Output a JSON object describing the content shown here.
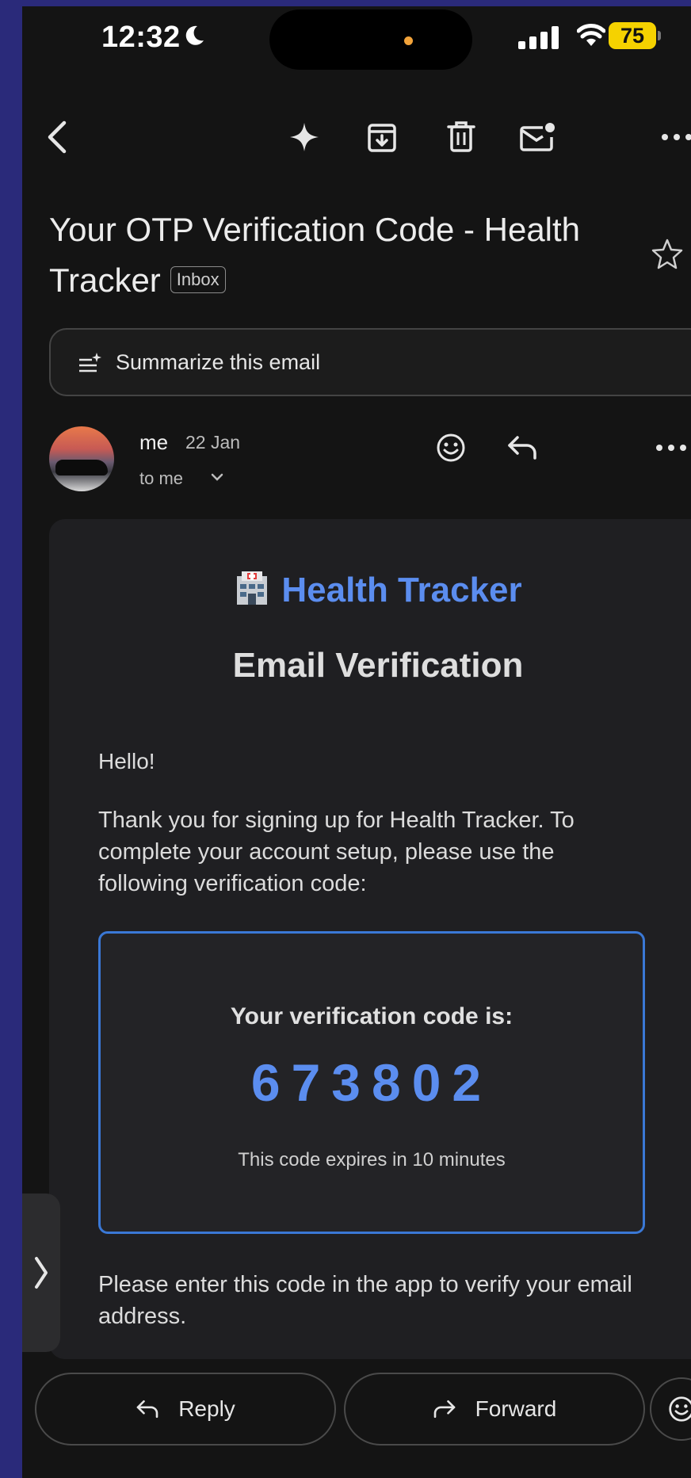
{
  "status_bar": {
    "time": "12:32",
    "battery": "75"
  },
  "email": {
    "subject": "Your OTP Verification Code - Health Tracker",
    "label": "Inbox",
    "summarize_label": "Summarize this email",
    "sender": "me",
    "date": "22 Jan",
    "recipient": "to me"
  },
  "body": {
    "brand": "Health Tracker",
    "heading": "Email Verification",
    "greeting": "Hello!",
    "intro": "Thank you for signing up for Health Tracker. To complete your account setup, please use the following verification code:",
    "code_lead": "Your verification code is:",
    "code": "673802",
    "expiry": "This code expires in 10 minutes",
    "outro": "Please enter this code in the app to verify your email address."
  },
  "actions": {
    "reply": "Reply",
    "forward": "Forward"
  },
  "icons": {
    "toolbar": [
      "back-icon",
      "sparkle-icon",
      "archive-icon",
      "trash-icon",
      "mark-unread-icon",
      "more-icon"
    ],
    "sender_row": [
      "emoji-icon",
      "reply-icon",
      "more-icon"
    ]
  },
  "colors": {
    "accent": "#5b8def",
    "code_border": "#3a78d6",
    "battery": "#f5d200",
    "background": "#141414"
  }
}
